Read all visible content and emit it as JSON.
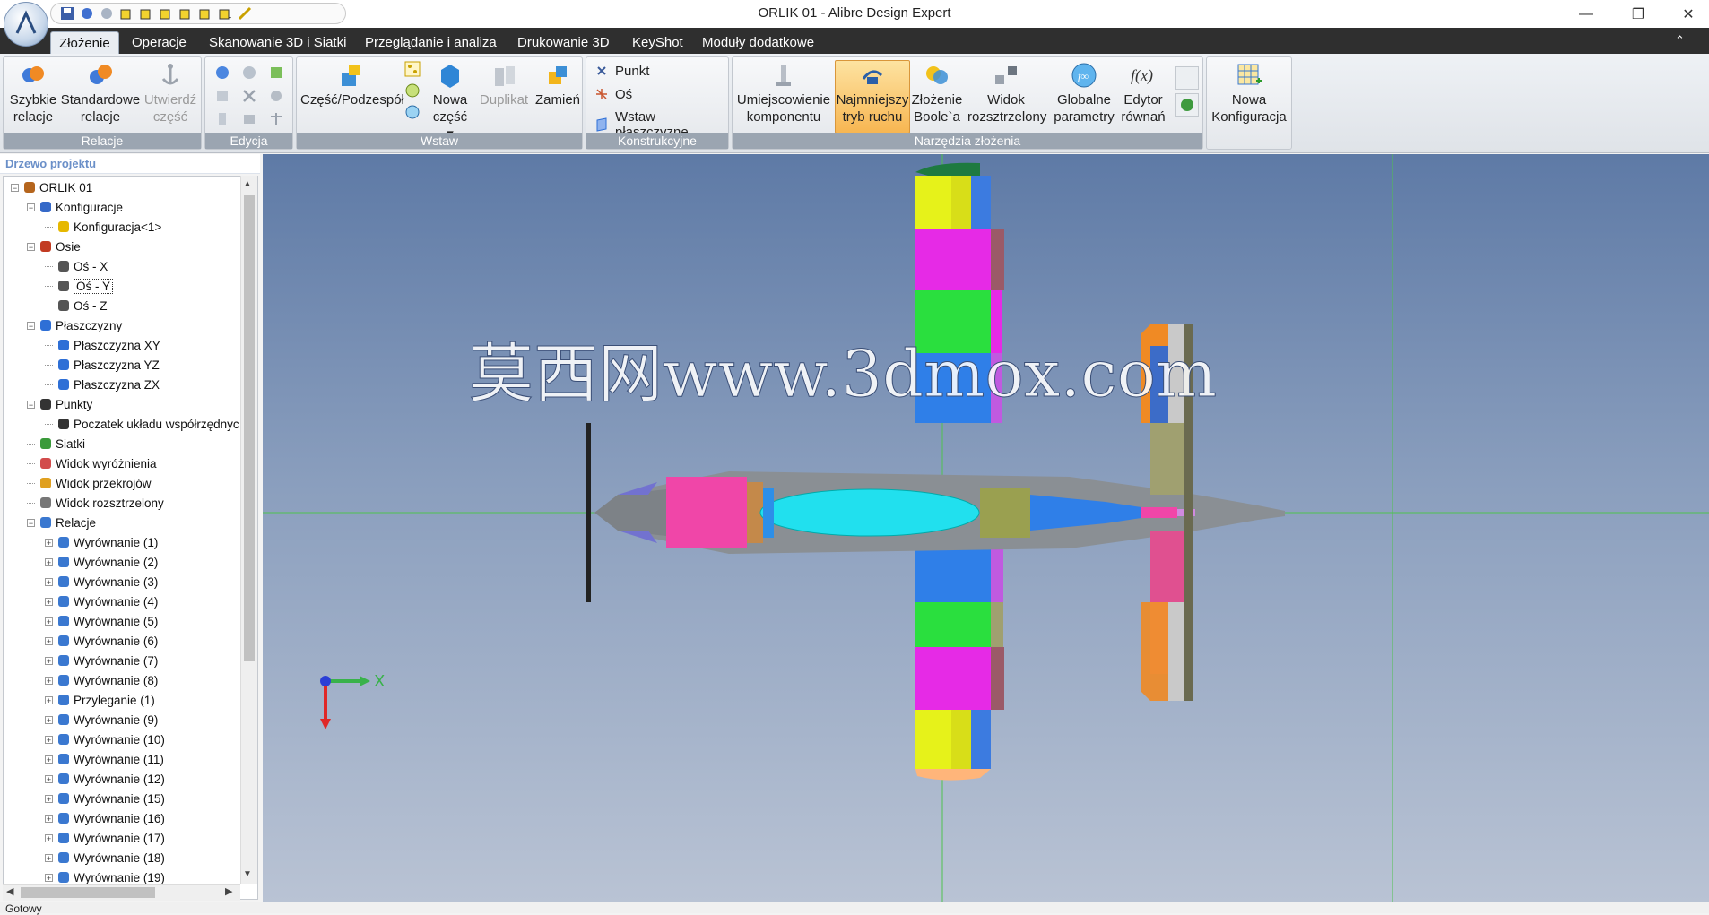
{
  "window": {
    "title": "ORLIK 01 - Alibre Design Expert",
    "controls": [
      "—",
      "❐",
      "✕"
    ]
  },
  "tabs": [
    {
      "label": "Złożenie",
      "active": true
    },
    {
      "label": "Operacje"
    },
    {
      "label": "Skanowanie 3D i Siatki"
    },
    {
      "label": "Przeglądanie i analiza"
    },
    {
      "label": "Drukowanie 3D"
    },
    {
      "label": "KeyShot"
    },
    {
      "label": "Moduły dodatkowe"
    }
  ],
  "ribbon": {
    "relacje": {
      "label": "Relacje",
      "quick": [
        "Szybkie",
        "relacje"
      ],
      "standard": [
        "Standardowe",
        "relacje"
      ],
      "anchor": [
        "Utwierdź",
        "część"
      ]
    },
    "edycja": {
      "label": "Edycja"
    },
    "wstaw": {
      "label": "Wstaw",
      "part": "Część/Podzespół",
      "new_part": [
        "Nowa",
        "część ▾"
      ],
      "duplicate": "Duplikat",
      "replace": "Zamień"
    },
    "konstrukcyjne": {
      "label": "Konstrukcyjne",
      "point": "Punkt",
      "axis": "Oś",
      "plane": "Wstaw płaszczyznę"
    },
    "narzedzia": {
      "label": "Narzędzia złożenia",
      "placement": [
        "Umiejscowienie",
        "komponentu"
      ],
      "min_motion": [
        "Najmniejszy",
        "tryb ruchu"
      ],
      "boolean": [
        "Złożenie",
        "Boole`a"
      ],
      "exploded": [
        "Widok",
        "rozsztrzelony"
      ],
      "global": [
        "Globalne",
        "parametry"
      ],
      "equation": [
        "Edytor",
        "równań"
      ]
    },
    "config": {
      "new": [
        "Nowa",
        "Konfiguracja"
      ]
    }
  },
  "tree": {
    "header": "Drzewo projektu",
    "nodes": [
      {
        "label": "ORLIK 01",
        "level": 0,
        "exp": "−",
        "icon": "assembly-icon",
        "color": "#b5651d"
      },
      {
        "label": "Konfiguracje",
        "level": 1,
        "exp": "−",
        "icon": "folder-icon",
        "color": "#3569c8"
      },
      {
        "label": "Konfiguracja<1>",
        "level": 2,
        "exp": "",
        "icon": "config-icon",
        "color": "#e6b800"
      },
      {
        "label": "Osie",
        "level": 1,
        "exp": "−",
        "icon": "axes-icon",
        "color": "#c23b22"
      },
      {
        "label": "Oś - X",
        "level": 2,
        "exp": "",
        "icon": "axis-icon",
        "color": "#555"
      },
      {
        "label": "Oś - Y",
        "level": 2,
        "exp": "",
        "icon": "axis-icon",
        "color": "#555",
        "selected": true
      },
      {
        "label": "Oś - Z",
        "level": 2,
        "exp": "",
        "icon": "axis-icon",
        "color": "#555"
      },
      {
        "label": "Płaszczyzny",
        "level": 1,
        "exp": "−",
        "icon": "planes-icon",
        "color": "#2e6fd6"
      },
      {
        "label": "Płaszczyzna XY",
        "level": 2,
        "exp": "",
        "icon": "plane-icon",
        "color": "#2e6fd6"
      },
      {
        "label": "Płaszczyzna YZ",
        "level": 2,
        "exp": "",
        "icon": "plane-icon",
        "color": "#2e6fd6"
      },
      {
        "label": "Płaszczyzna ZX",
        "level": 2,
        "exp": "",
        "icon": "plane-icon",
        "color": "#2e6fd6"
      },
      {
        "label": "Punkty",
        "level": 1,
        "exp": "−",
        "icon": "points-icon",
        "color": "#333"
      },
      {
        "label": "Poczatek układu współrzędnyc",
        "level": 2,
        "exp": "",
        "icon": "origin-icon",
        "color": "#333"
      },
      {
        "label": "Siatki",
        "level": 1,
        "exp": "",
        "icon": "mesh-icon",
        "color": "#3a9a3a"
      },
      {
        "label": "Widok wyróżnienia",
        "level": 1,
        "exp": "",
        "icon": "highlight-icon",
        "color": "#d24b4b"
      },
      {
        "label": "Widok przekrojów",
        "level": 1,
        "exp": "",
        "icon": "section-icon",
        "color": "#e0a020"
      },
      {
        "label": "Widok rozsztrzelony",
        "level": 1,
        "exp": "",
        "icon": "explode-icon",
        "color": "#777"
      },
      {
        "label": "Relacje",
        "level": 1,
        "exp": "−",
        "icon": "constraints-icon",
        "color": "#3a78d0"
      },
      {
        "label": "Wyrównanie (1)",
        "level": 2,
        "exp": "+",
        "icon": "align-icon",
        "color": "#3a78d0"
      },
      {
        "label": "Wyrównanie (2)",
        "level": 2,
        "exp": "+",
        "icon": "align-icon",
        "color": "#3a78d0"
      },
      {
        "label": "Wyrównanie (3)",
        "level": 2,
        "exp": "+",
        "icon": "align-icon",
        "color": "#3a78d0"
      },
      {
        "label": "Wyrównanie (4)",
        "level": 2,
        "exp": "+",
        "icon": "align-icon",
        "color": "#3a78d0"
      },
      {
        "label": "Wyrównanie (5)",
        "level": 2,
        "exp": "+",
        "icon": "align-icon",
        "color": "#3a78d0"
      },
      {
        "label": "Wyrównanie (6)",
        "level": 2,
        "exp": "+",
        "icon": "align-icon",
        "color": "#3a78d0"
      },
      {
        "label": "Wyrównanie (7)",
        "level": 2,
        "exp": "+",
        "icon": "align-icon",
        "color": "#3a78d0"
      },
      {
        "label": "Wyrównanie (8)",
        "level": 2,
        "exp": "+",
        "icon": "align-icon",
        "color": "#3a78d0"
      },
      {
        "label": "Przyleganie (1)",
        "level": 2,
        "exp": "+",
        "icon": "mate-icon",
        "color": "#3a78d0"
      },
      {
        "label": "Wyrównanie (9)",
        "level": 2,
        "exp": "+",
        "icon": "align-icon",
        "color": "#3a78d0"
      },
      {
        "label": "Wyrównanie (10)",
        "level": 2,
        "exp": "+",
        "icon": "align-icon",
        "color": "#3a78d0"
      },
      {
        "label": "Wyrównanie (11)",
        "level": 2,
        "exp": "+",
        "icon": "align-icon",
        "color": "#3a78d0"
      },
      {
        "label": "Wyrównanie (12)",
        "level": 2,
        "exp": "+",
        "icon": "align-icon",
        "color": "#3a78d0"
      },
      {
        "label": "Wyrównanie (15)",
        "level": 2,
        "exp": "+",
        "icon": "align-icon",
        "color": "#3a78d0"
      },
      {
        "label": "Wyrównanie (16)",
        "level": 2,
        "exp": "+",
        "icon": "align-icon",
        "color": "#3a78d0"
      },
      {
        "label": "Wyrównanie (17)",
        "level": 2,
        "exp": "+",
        "icon": "align-icon",
        "color": "#3a78d0"
      },
      {
        "label": "Wyrównanie (18)",
        "level": 2,
        "exp": "+",
        "icon": "align-icon",
        "color": "#3a78d0"
      },
      {
        "label": "Wyrównanie (19)",
        "level": 2,
        "exp": "+",
        "icon": "align-icon",
        "color": "#3a78d0"
      }
    ]
  },
  "viewport": {
    "watermark": "莫西网www.3dmox.com",
    "triad_x_label": "X"
  },
  "status": {
    "text": "Gotowy"
  }
}
